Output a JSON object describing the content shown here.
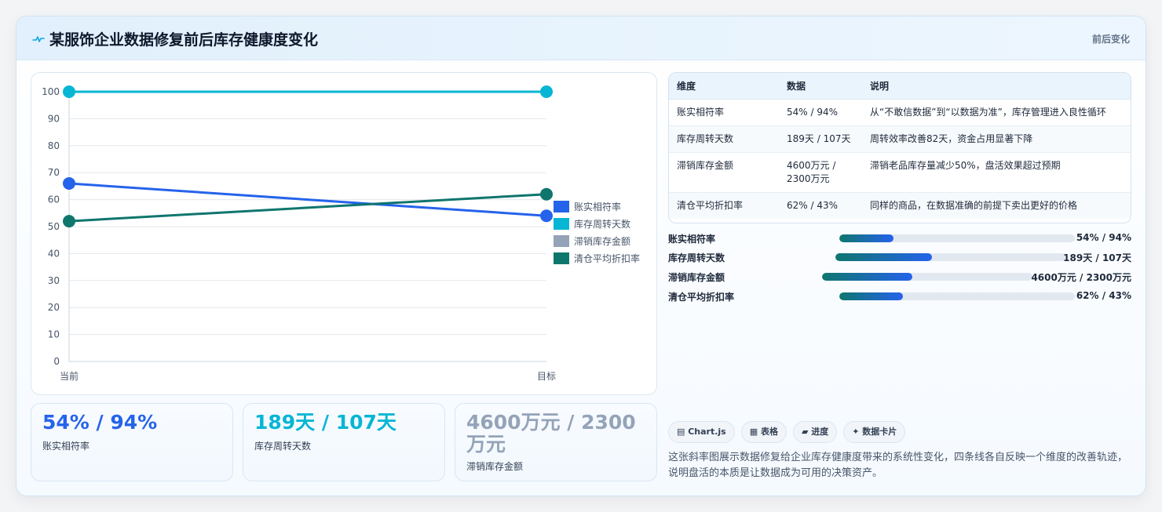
{
  "header": {
    "title": "某服饰企业数据修复前后库存健康度变化",
    "tag": "前后变化"
  },
  "chart_data": {
    "type": "line",
    "categories": [
      "当前",
      "目标"
    ],
    "ylim": [
      0,
      100
    ],
    "yticks": [
      0,
      10,
      20,
      30,
      40,
      50,
      60,
      70,
      80,
      90,
      100
    ],
    "legend_position": "right",
    "grid": true,
    "series": [
      {
        "name": "账实相符率",
        "values": [
          66,
          54
        ],
        "color": "#2563eb"
      },
      {
        "name": "库存周转天数",
        "values": [
          100,
          100
        ],
        "color": "#06b6d4"
      },
      {
        "name": "滞销库存金额",
        "values": [
          null,
          null
        ],
        "color": "#94a3b8"
      },
      {
        "name": "清仓平均折扣率",
        "values": [
          52,
          62
        ],
        "color": "#0f766e"
      }
    ]
  },
  "stats": [
    {
      "value": "54% / 94%",
      "label": "账实相符率",
      "color": "#2563eb"
    },
    {
      "value": "189天 / 107天",
      "label": "库存周转天数",
      "color": "#06b6d4"
    },
    {
      "value": "4600万元 / 2300万元",
      "label": "滞销库存金额",
      "color": "#94a3b8"
    }
  ],
  "table": {
    "headers": [
      "维度",
      "数据",
      "说明"
    ],
    "rows": [
      [
        "账实相符率",
        "54% / 94%",
        "从“不敢信数据”到“以数据为准”，库存管理进入良性循环"
      ],
      [
        "库存周转天数",
        "189天 / 107天",
        "周转效率改善82天，资金占用显著下降"
      ],
      [
        "滞销库存金额",
        "4600万元 / 2300万元",
        "滞销老品库存量减少50%，盘活效果超过预期"
      ],
      [
        "清仓平均折扣率",
        "62% / 43%",
        "同样的商品，在数据准确的前提下卖出更好的价格"
      ]
    ]
  },
  "bars": [
    {
      "label": "账实相符率",
      "value": "54% / 94%",
      "fraction": 0.23
    },
    {
      "label": "库存周转天数",
      "value": "189天 / 107天",
      "fraction": 0.42
    },
    {
      "label": "滞销库存金额",
      "value": "4600万元 / 2300万元",
      "fraction": 0.43
    },
    {
      "label": "清仓平均折扣率",
      "value": "62% / 43%",
      "fraction": 0.27
    }
  ],
  "chips": [
    "▤ Chart.js",
    "▦ 表格",
    "▰ 进度",
    "✦ 数据卡片"
  ],
  "description": "这张斜率图展示数据修复给企业库存健康度带来的系统性变化，四条线各自反映一个维度的改善轨迹，说明盘活的本质是让数据成为可用的决策资产。",
  "icons": {
    "logo": "pulse-icon"
  }
}
